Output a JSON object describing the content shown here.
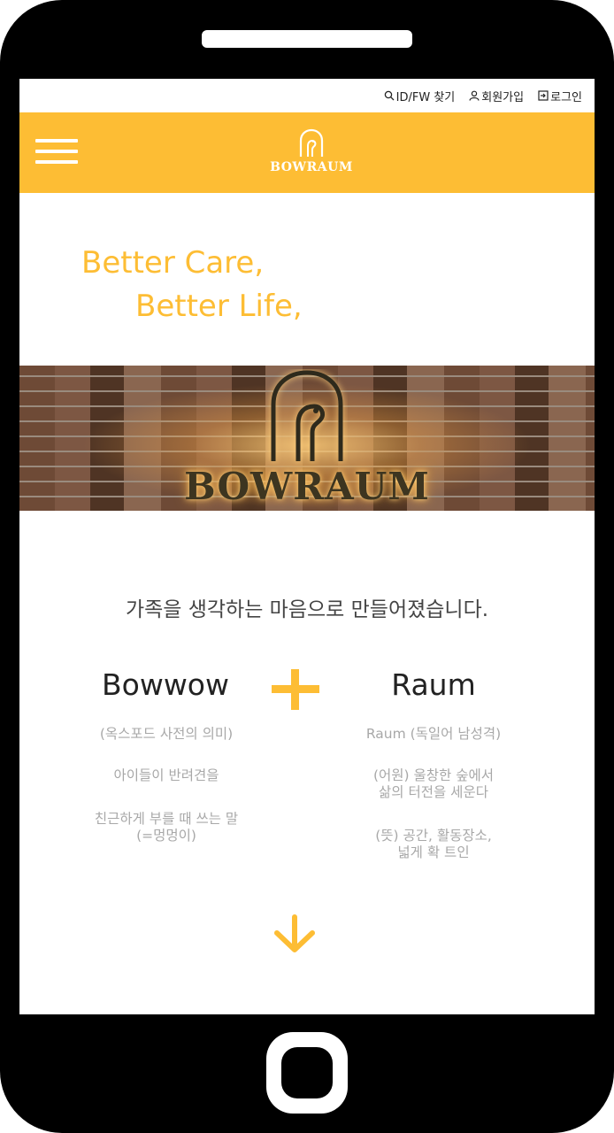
{
  "util": {
    "find_id": "ID/FW 찾기",
    "signup": "회원가입",
    "login": "로그인"
  },
  "header": {
    "logo_text": "BOWRAUM"
  },
  "hero": {
    "line1": "Better Care,",
    "line2": "Better Life,"
  },
  "banner": {
    "text": "BOWRAUM"
  },
  "slogan": "가족을 생각하는 마음으로 만들어졌습니다.",
  "left": {
    "title": "Bowwow",
    "desc1": "(옥스포드 사전의 의미)",
    "desc2": "아이들이 반려견을",
    "desc3": "친근하게 부를 때 쓰는 말\n(=멍멍이)"
  },
  "right": {
    "title": "Raum",
    "desc1": "Raum (독일어 남성격)",
    "desc2": "(어원) 울창한 숲에서\n삶의 터전을 세운다",
    "desc3": "(뜻) 공간, 활동장소,\n넓게 확 트인"
  },
  "colors": {
    "accent": "#fdbd34",
    "frame": "#000000"
  }
}
